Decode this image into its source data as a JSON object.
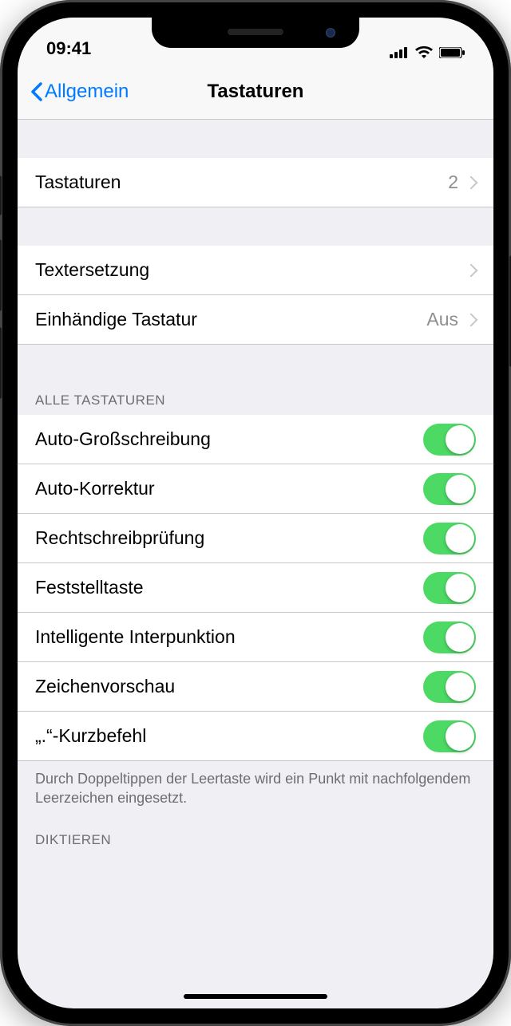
{
  "status": {
    "time": "09:41"
  },
  "nav": {
    "back": "Allgemein",
    "title": "Tastaturen"
  },
  "rows": {
    "keyboards": {
      "label": "Tastaturen",
      "value": "2"
    },
    "text_replacement": {
      "label": "Textersetzung"
    },
    "one_handed": {
      "label": "Einhändige Tastatur",
      "value": "Aus"
    }
  },
  "section_all": {
    "header": "ALLE TASTATUREN",
    "footer": "Durch Doppeltippen der Leertaste wird ein Punkt mit nachfolgendem Leerzeichen eingesetzt."
  },
  "toggles": {
    "auto_cap": {
      "label": "Auto-Großschreibung",
      "on": true
    },
    "auto_correct": {
      "label": "Auto-Korrektur",
      "on": true
    },
    "spell_check": {
      "label": "Rechtschreibprüfung",
      "on": true
    },
    "caps_lock": {
      "label": "Feststelltaste",
      "on": true
    },
    "smart_punct": {
      "label": "Intelligente Interpunktion",
      "on": true
    },
    "char_preview": {
      "label": "Zeichenvorschau",
      "on": true
    },
    "period_shortcut": {
      "label": "„.“-Kurzbefehl",
      "on": true
    }
  },
  "section_dictate": {
    "header": "DIKTIEREN"
  }
}
